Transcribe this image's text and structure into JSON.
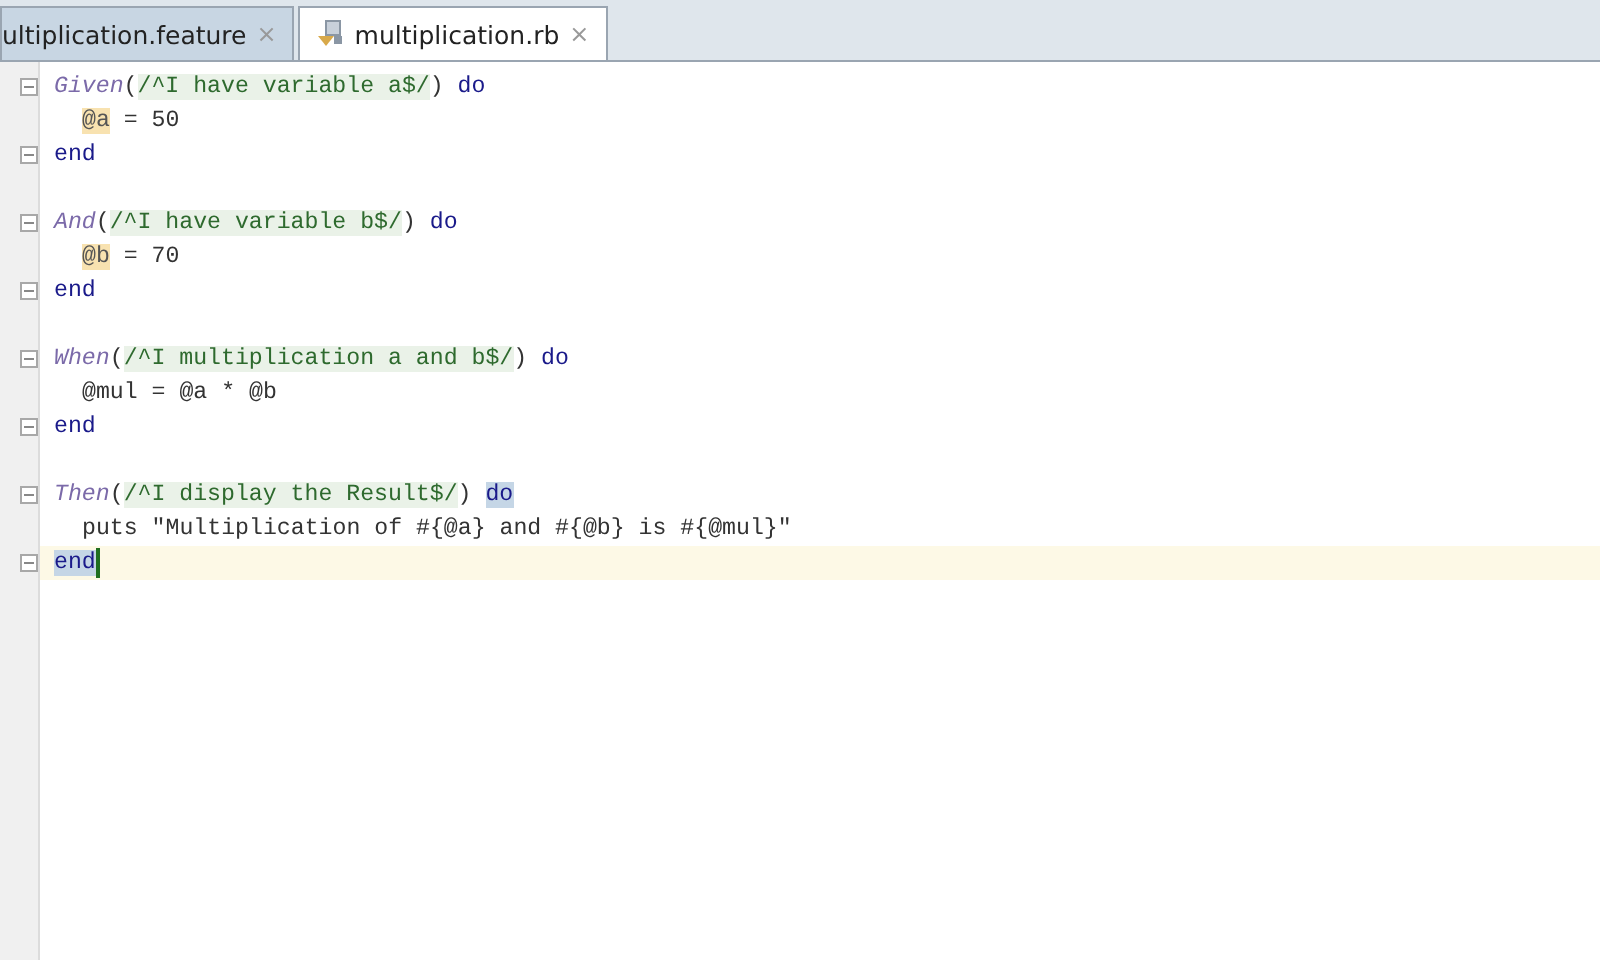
{
  "tabs": [
    {
      "label": "ultiplication.feature",
      "selected": false,
      "close": "×"
    },
    {
      "label": "multiplication.rb",
      "selected": true,
      "close": "×"
    }
  ],
  "code": [
    {
      "fold": true,
      "indent": false,
      "current": false,
      "tokens": [
        {
          "text": "Given",
          "kind": "step"
        },
        {
          "text": "(",
          "kind": "plain"
        },
        {
          "text": "/^I have variable a$/",
          "kind": "regex"
        },
        {
          "text": ") ",
          "kind": "plain"
        },
        {
          "text": "do",
          "kind": "keyword"
        }
      ]
    },
    {
      "fold": false,
      "indent": true,
      "current": false,
      "tokens": [
        {
          "text": "@a",
          "kind": "warn"
        },
        {
          "text": " = 50",
          "kind": "plain"
        }
      ]
    },
    {
      "fold": true,
      "indent": false,
      "current": false,
      "tokens": [
        {
          "text": "end",
          "kind": "keyword"
        }
      ]
    },
    {
      "fold": false,
      "current": false
    },
    {
      "fold": true,
      "indent": false,
      "current": false,
      "tokens": [
        {
          "text": "And",
          "kind": "step"
        },
        {
          "text": "(",
          "kind": "plain"
        },
        {
          "text": "/^I have variable b$/",
          "kind": "regex"
        },
        {
          "text": ") ",
          "kind": "plain"
        },
        {
          "text": "do",
          "kind": "keyword"
        }
      ]
    },
    {
      "fold": false,
      "indent": true,
      "current": false,
      "tokens": [
        {
          "text": "@b",
          "kind": "warn"
        },
        {
          "text": " = 70",
          "kind": "plain"
        }
      ]
    },
    {
      "fold": true,
      "indent": false,
      "current": false,
      "tokens": [
        {
          "text": "end",
          "kind": "keyword"
        }
      ]
    },
    {
      "fold": false,
      "current": false
    },
    {
      "fold": true,
      "indent": false,
      "current": false,
      "tokens": [
        {
          "text": "When",
          "kind": "step"
        },
        {
          "text": "(",
          "kind": "plain"
        },
        {
          "text": "/^I multiplication a and b$/",
          "kind": "regex"
        },
        {
          "text": ") ",
          "kind": "plain"
        },
        {
          "text": "do",
          "kind": "keyword"
        }
      ]
    },
    {
      "fold": false,
      "indent": true,
      "current": false,
      "tokens": [
        {
          "text": "@mul = @a * @b",
          "kind": "plain"
        }
      ]
    },
    {
      "fold": true,
      "indent": false,
      "current": false,
      "tokens": [
        {
          "text": "end",
          "kind": "keyword"
        }
      ]
    },
    {
      "fold": false,
      "current": false
    },
    {
      "fold": true,
      "indent": false,
      "current": false,
      "tokens": [
        {
          "text": "Then",
          "kind": "step"
        },
        {
          "text": "(",
          "kind": "plain"
        },
        {
          "text": "/^I display the Result$/",
          "kind": "regex"
        },
        {
          "text": ") ",
          "kind": "plain"
        },
        {
          "text": "do",
          "kind": "match"
        }
      ]
    },
    {
      "fold": false,
      "indent": true,
      "current": false,
      "tokens": [
        {
          "text": "puts ",
          "kind": "plain"
        },
        {
          "text": "\"Multiplication of #{@a} and #{@b} is #{@mul}\"",
          "kind": "string"
        }
      ]
    },
    {
      "fold": true,
      "indent": false,
      "current": true,
      "tokens": [
        {
          "text": "end",
          "kind": "match"
        }
      ]
    }
  ]
}
